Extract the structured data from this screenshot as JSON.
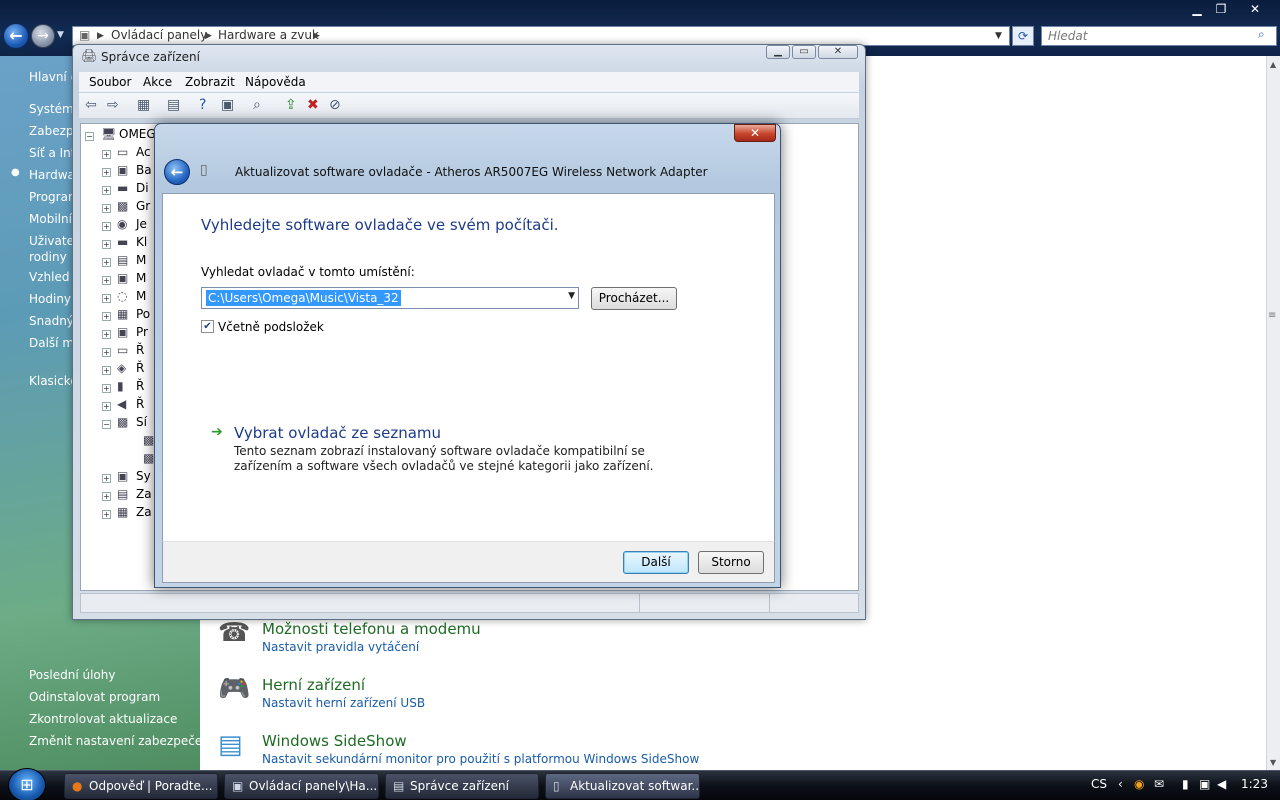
{
  "explorer": {
    "breadcrumbs": [
      "Ovládací panely",
      "Hardware a zvuk"
    ],
    "search_placeholder": "Hledat",
    "left_nav": [
      "Hlavní c",
      "Systém",
      "Zabezpe",
      "Síť a Int",
      "Hardwa",
      "Program",
      "Mobilní",
      "Uživatel",
      "rodiny",
      "Vzhled a",
      "Hodiny,",
      "Snadný",
      "Další mo",
      "Klasické"
    ],
    "tasks": [
      "Poslední úlohy",
      "Odinstalovat program",
      "Zkontrolovat aktualizace",
      "Změnit nastavení zabezpečení"
    ],
    "categories": [
      {
        "title": "Možnosti telefonu a modemu",
        "subtitle": "Nastavit pravidla vytáčení",
        "icon": "phone-icon"
      },
      {
        "title": "Herní zařízení",
        "subtitle": "Nastavit herní zařízení USB",
        "icon": "gamepad-icon"
      },
      {
        "title": "Windows SideShow",
        "subtitle": "Nastavit sekundární monitor pro použití s platformou Windows SideShow",
        "icon": "sideshow-icon"
      }
    ]
  },
  "devmgr": {
    "title": "Správce zařízení",
    "menu": [
      "Soubor",
      "Akce",
      "Zobrazit",
      "Nápověda"
    ],
    "root": "OMEG",
    "nodes": [
      "Ac",
      "Ba",
      "Di",
      "Gr",
      "Je",
      "Kl",
      "M",
      "M",
      "M",
      "Po",
      "Pr",
      "Ř",
      "Ř",
      "Ř",
      "Ř",
      "Sí",
      "",
      "",
      "Sy",
      "Za",
      "Za"
    ]
  },
  "wizard": {
    "title": "Aktualizovat software ovladače - Atheros AR5007EG Wireless Network Adapter",
    "heading": "Vyhledejte software ovladače ve svém počítači.",
    "path_label": "Vyhledat ovladač v tomto umístění:",
    "path_value": "C:\\Users\\Omega\\Music\\Vista_32",
    "browse": "Procházet...",
    "include_subfolders": "Včetně podsložek",
    "pick_title": "Vybrat ovladač ze seznamu",
    "pick_desc": "Tento seznam zobrazí instalovaný software ovladače kompatibilní se zařízením a software všech ovladačů ve stejné kategorii jako zařízení.",
    "next": "Další",
    "cancel": "Storno"
  },
  "taskbar": {
    "buttons": [
      "Odpověď | Poradte...",
      "Ovládací panely\\Ha...",
      "Správce zařízení",
      "Aktualizovat softwar..."
    ],
    "lang": "CS",
    "clock": "1:23"
  },
  "colors": {
    "accent": "#1e3b8a",
    "link": "#1a5ca8",
    "category": "#1e6b24"
  }
}
